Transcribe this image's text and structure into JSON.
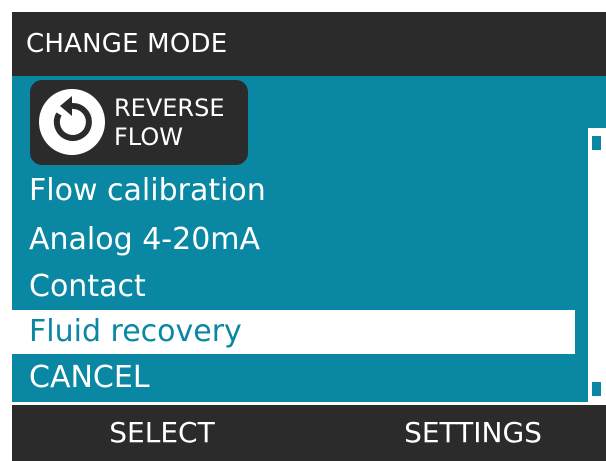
{
  "header": {
    "title": "CHANGE MODE"
  },
  "current_mode": {
    "icon": "reverse-rotation-icon",
    "label": "REVERSE\nFLOW"
  },
  "menu": {
    "items": [
      {
        "label": "Flow calibration",
        "selected": false
      },
      {
        "label": "Analog 4-20mA",
        "selected": false
      },
      {
        "label": "Contact",
        "selected": false
      },
      {
        "label": "Fluid recovery",
        "selected": true
      },
      {
        "label": "CANCEL",
        "selected": false
      }
    ]
  },
  "softkeys": {
    "left": "SELECT",
    "right": "SETTINGS"
  },
  "colors": {
    "background": "#0a87a3",
    "bars": "#2b2b2b",
    "highlight": "#ffffff",
    "text": "#ffffff"
  }
}
